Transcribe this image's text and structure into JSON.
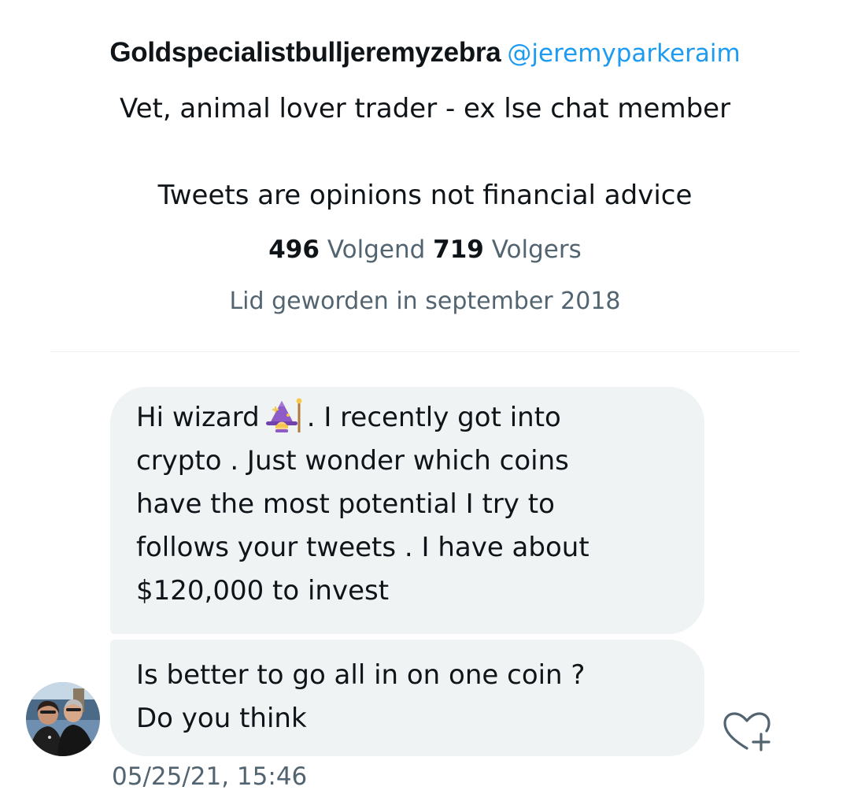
{
  "profile": {
    "display_name": "Goldspecialistbulljeremyzebra",
    "handle": "@jeremyparkeraim",
    "bio_line_1": "Vet, animal lover trader - ex lse chat member",
    "bio_line_2": "Tweets are opinions not financial advice",
    "following_count": "496",
    "following_label": "Volgend",
    "followers_count": "719",
    "followers_label": "Volgers",
    "joined": "Lid geworden in september 2018"
  },
  "messages": [
    {
      "lines": [
        {
          "before_emoji": "Hi wizard",
          "emoji": "woman-mage-emoji",
          "after_emoji": ". I recently got into"
        },
        {
          "text": "crypto . Just wonder which coins"
        },
        {
          "text": "have the most potential I try to"
        },
        {
          "text": "follows your tweets . I have about"
        },
        {
          "text": "$120,000 to invest"
        }
      ]
    },
    {
      "lines": [
        {
          "text": "Is better to go all in on one coin ?"
        },
        {
          "text": "Do you think"
        }
      ]
    }
  ],
  "timestamp": "05/25/21, 15:46",
  "icons": {
    "avatar": "sender-avatar",
    "like": "heart-plus-icon"
  },
  "colors": {
    "accent": "#1d9bf0",
    "secondary_text": "#536471",
    "bubble_bg": "#eff3f4",
    "primary_text": "#0f1419"
  }
}
